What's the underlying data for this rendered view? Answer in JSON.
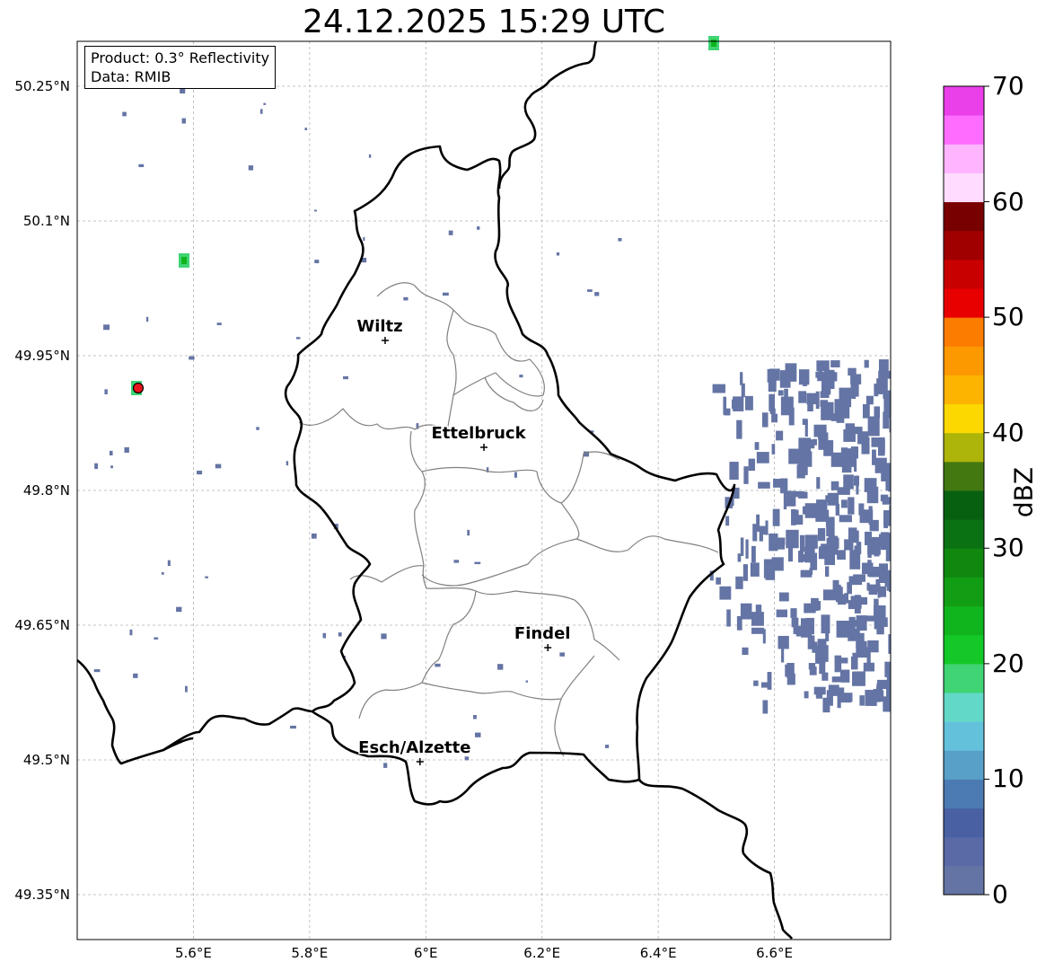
{
  "title": "24.12.2025 15:29 UTC",
  "info": {
    "product": "Product: 0.3° Reflectivity",
    "data": "Data: RMIB"
  },
  "map": {
    "lon_range": [
      5.4,
      6.8
    ],
    "lat_range": [
      49.3,
      50.3
    ],
    "lon_ticks": [
      {
        "value": 5.6,
        "label": "5.6°E"
      },
      {
        "value": 5.8,
        "label": "5.8°E"
      },
      {
        "value": 6.0,
        "label": "6°E"
      },
      {
        "value": 6.2,
        "label": "6.2°E"
      },
      {
        "value": 6.4,
        "label": "6.4°E"
      },
      {
        "value": 6.6,
        "label": "6.6°E"
      }
    ],
    "lat_ticks": [
      {
        "value": 49.35,
        "label": "49.35°N"
      },
      {
        "value": 49.5,
        "label": "49.5°N"
      },
      {
        "value": 49.65,
        "label": "49.65°N"
      },
      {
        "value": 49.8,
        "label": "49.8°N"
      },
      {
        "value": 49.95,
        "label": "49.95°N"
      },
      {
        "value": 50.1,
        "label": "50.1°N"
      },
      {
        "value": 50.25,
        "label": "50.25°N"
      }
    ],
    "cities": [
      {
        "name": "Wiltz",
        "lon": 5.93,
        "lat": 49.967
      },
      {
        "name": "Ettelbruck",
        "lon": 6.1,
        "lat": 49.848
      },
      {
        "name": "Findel",
        "lon": 6.21,
        "lat": 49.625
      },
      {
        "name": "Esch/Alzette",
        "lon": 5.99,
        "lat": 49.498
      }
    ],
    "radar_site": {
      "lon": 5.505,
      "lat": 49.914,
      "color": "#e8141c"
    },
    "border_color": "#000000",
    "canton_color": "#808080"
  },
  "colorbar": {
    "label": "dBZ",
    "min": 0,
    "max": 70,
    "step": 2.5,
    "ticks": [
      {
        "value": 0,
        "label": "0"
      },
      {
        "value": 10,
        "label": "10"
      },
      {
        "value": 20,
        "label": "20"
      },
      {
        "value": 30,
        "label": "30"
      },
      {
        "value": 40,
        "label": "40"
      },
      {
        "value": 50,
        "label": "50"
      },
      {
        "value": 60,
        "label": "60"
      },
      {
        "value": 70,
        "label": "70"
      }
    ],
    "colors": [
      "#6474a4",
      "#5a6aa6",
      "#4960a3",
      "#4c7ab2",
      "#58a0c8",
      "#64c1dc",
      "#62d9c8",
      "#40d474",
      "#14c828",
      "#10b41c",
      "#129e14",
      "#10880e",
      "#0a7212",
      "#066010",
      "#437810",
      "#adb40a",
      "#fcd800",
      "#fcb400",
      "#fc9800",
      "#fc7c00",
      "#e80000",
      "#c80000",
      "#a00000",
      "#780000",
      "#ffdcff",
      "#ffb4ff",
      "#ff6cff",
      "#ea40ea"
    ]
  }
}
